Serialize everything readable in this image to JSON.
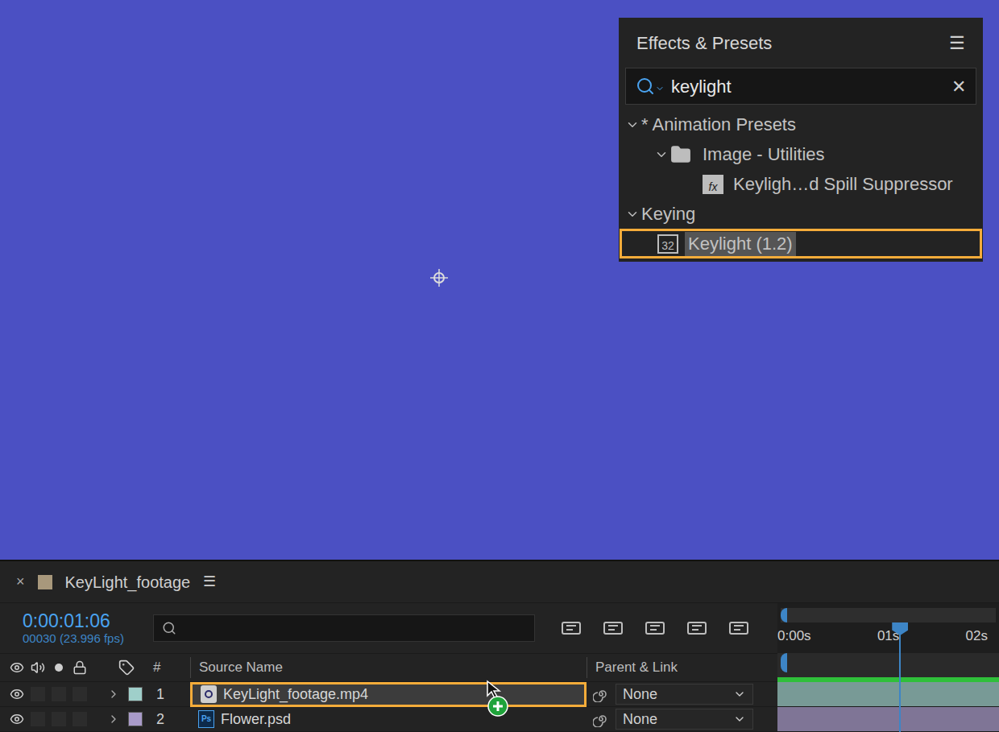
{
  "viewer": {
    "anchor_point": true
  },
  "effects_panel": {
    "title": "Effects & Presets",
    "menu": "☰",
    "search": {
      "value": "keylight",
      "clear": "✕"
    },
    "tree": [
      {
        "label": "* Animation Presets",
        "kind": "group",
        "depth": 0,
        "expanded": true,
        "highlighted": false
      },
      {
        "label": "Image - Utilities",
        "kind": "folder",
        "depth": 1,
        "expanded": true,
        "highlighted": false
      },
      {
        "label": "Keyligh…d Spill Suppressor",
        "kind": "preset",
        "depth": 2,
        "icon_text": "fx",
        "highlighted": false
      },
      {
        "label": "Keying",
        "kind": "group",
        "depth": 0,
        "expanded": true,
        "highlighted": false
      },
      {
        "label": "Keylight (1.2)",
        "kind": "effect",
        "depth": 1,
        "icon_text": "32",
        "highlighted": true
      }
    ]
  },
  "composition": {
    "close": "×",
    "name": "KeyLight_footage",
    "menu": "☰",
    "color": "#a8987c",
    "timecode": "0:00:01:06",
    "frames": "00030 (23.996 fps)",
    "ruler": [
      "0:00s",
      "01s",
      "02s"
    ],
    "playhead": {
      "level": 0.55
    }
  },
  "columns": [
    "#",
    "Source Name",
    "Parent & Link"
  ],
  "layers": [
    {
      "index": "1",
      "name": "KeyLight_footage.mp4",
      "parent": "None",
      "kind": "footage",
      "icon_text": "",
      "color": "#9fcfca",
      "visible": true,
      "highlighted": true,
      "drop_target": true
    },
    {
      "index": "2",
      "name": "Flower.psd",
      "parent": "None",
      "kind": "psd",
      "icon_text": "Ps",
      "color": "#a99bc9",
      "visible": true,
      "highlighted": false,
      "drop_target": false
    }
  ]
}
